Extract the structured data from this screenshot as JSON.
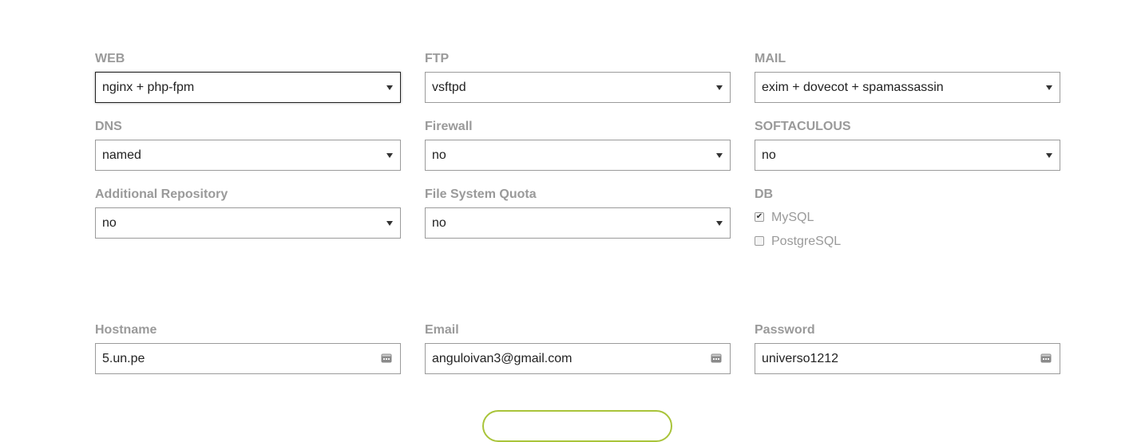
{
  "web": {
    "label": "WEB",
    "value": "nginx + php-fpm"
  },
  "ftp": {
    "label": "FTP",
    "value": "vsftpd"
  },
  "mail": {
    "label": "MAIL",
    "value": "exim + dovecot + spamassassin"
  },
  "dns": {
    "label": "DNS",
    "value": "named"
  },
  "firewall": {
    "label": "Firewall",
    "value": "no"
  },
  "softaculous": {
    "label": "SOFTACULOUS",
    "value": "no"
  },
  "repository": {
    "label": "Additional Repository",
    "value": "no"
  },
  "quota": {
    "label": "File System Quota",
    "value": "no"
  },
  "db": {
    "label": "DB",
    "options": [
      {
        "label": "MySQL",
        "checked": true
      },
      {
        "label": "PostgreSQL",
        "checked": false
      }
    ]
  },
  "hostname": {
    "label": "Hostname",
    "value": "5.un.pe"
  },
  "email": {
    "label": "Email",
    "value": "anguloivan3@gmail.com"
  },
  "password": {
    "label": "Password",
    "value": "universo1212"
  },
  "colors": {
    "accent": "#a9c43a",
    "label": "#9a9a9a",
    "border": "#9b9b9b"
  },
  "icons": {
    "select_arrow": "triangle-down-icon",
    "field_menu": "password-manager-icon"
  }
}
